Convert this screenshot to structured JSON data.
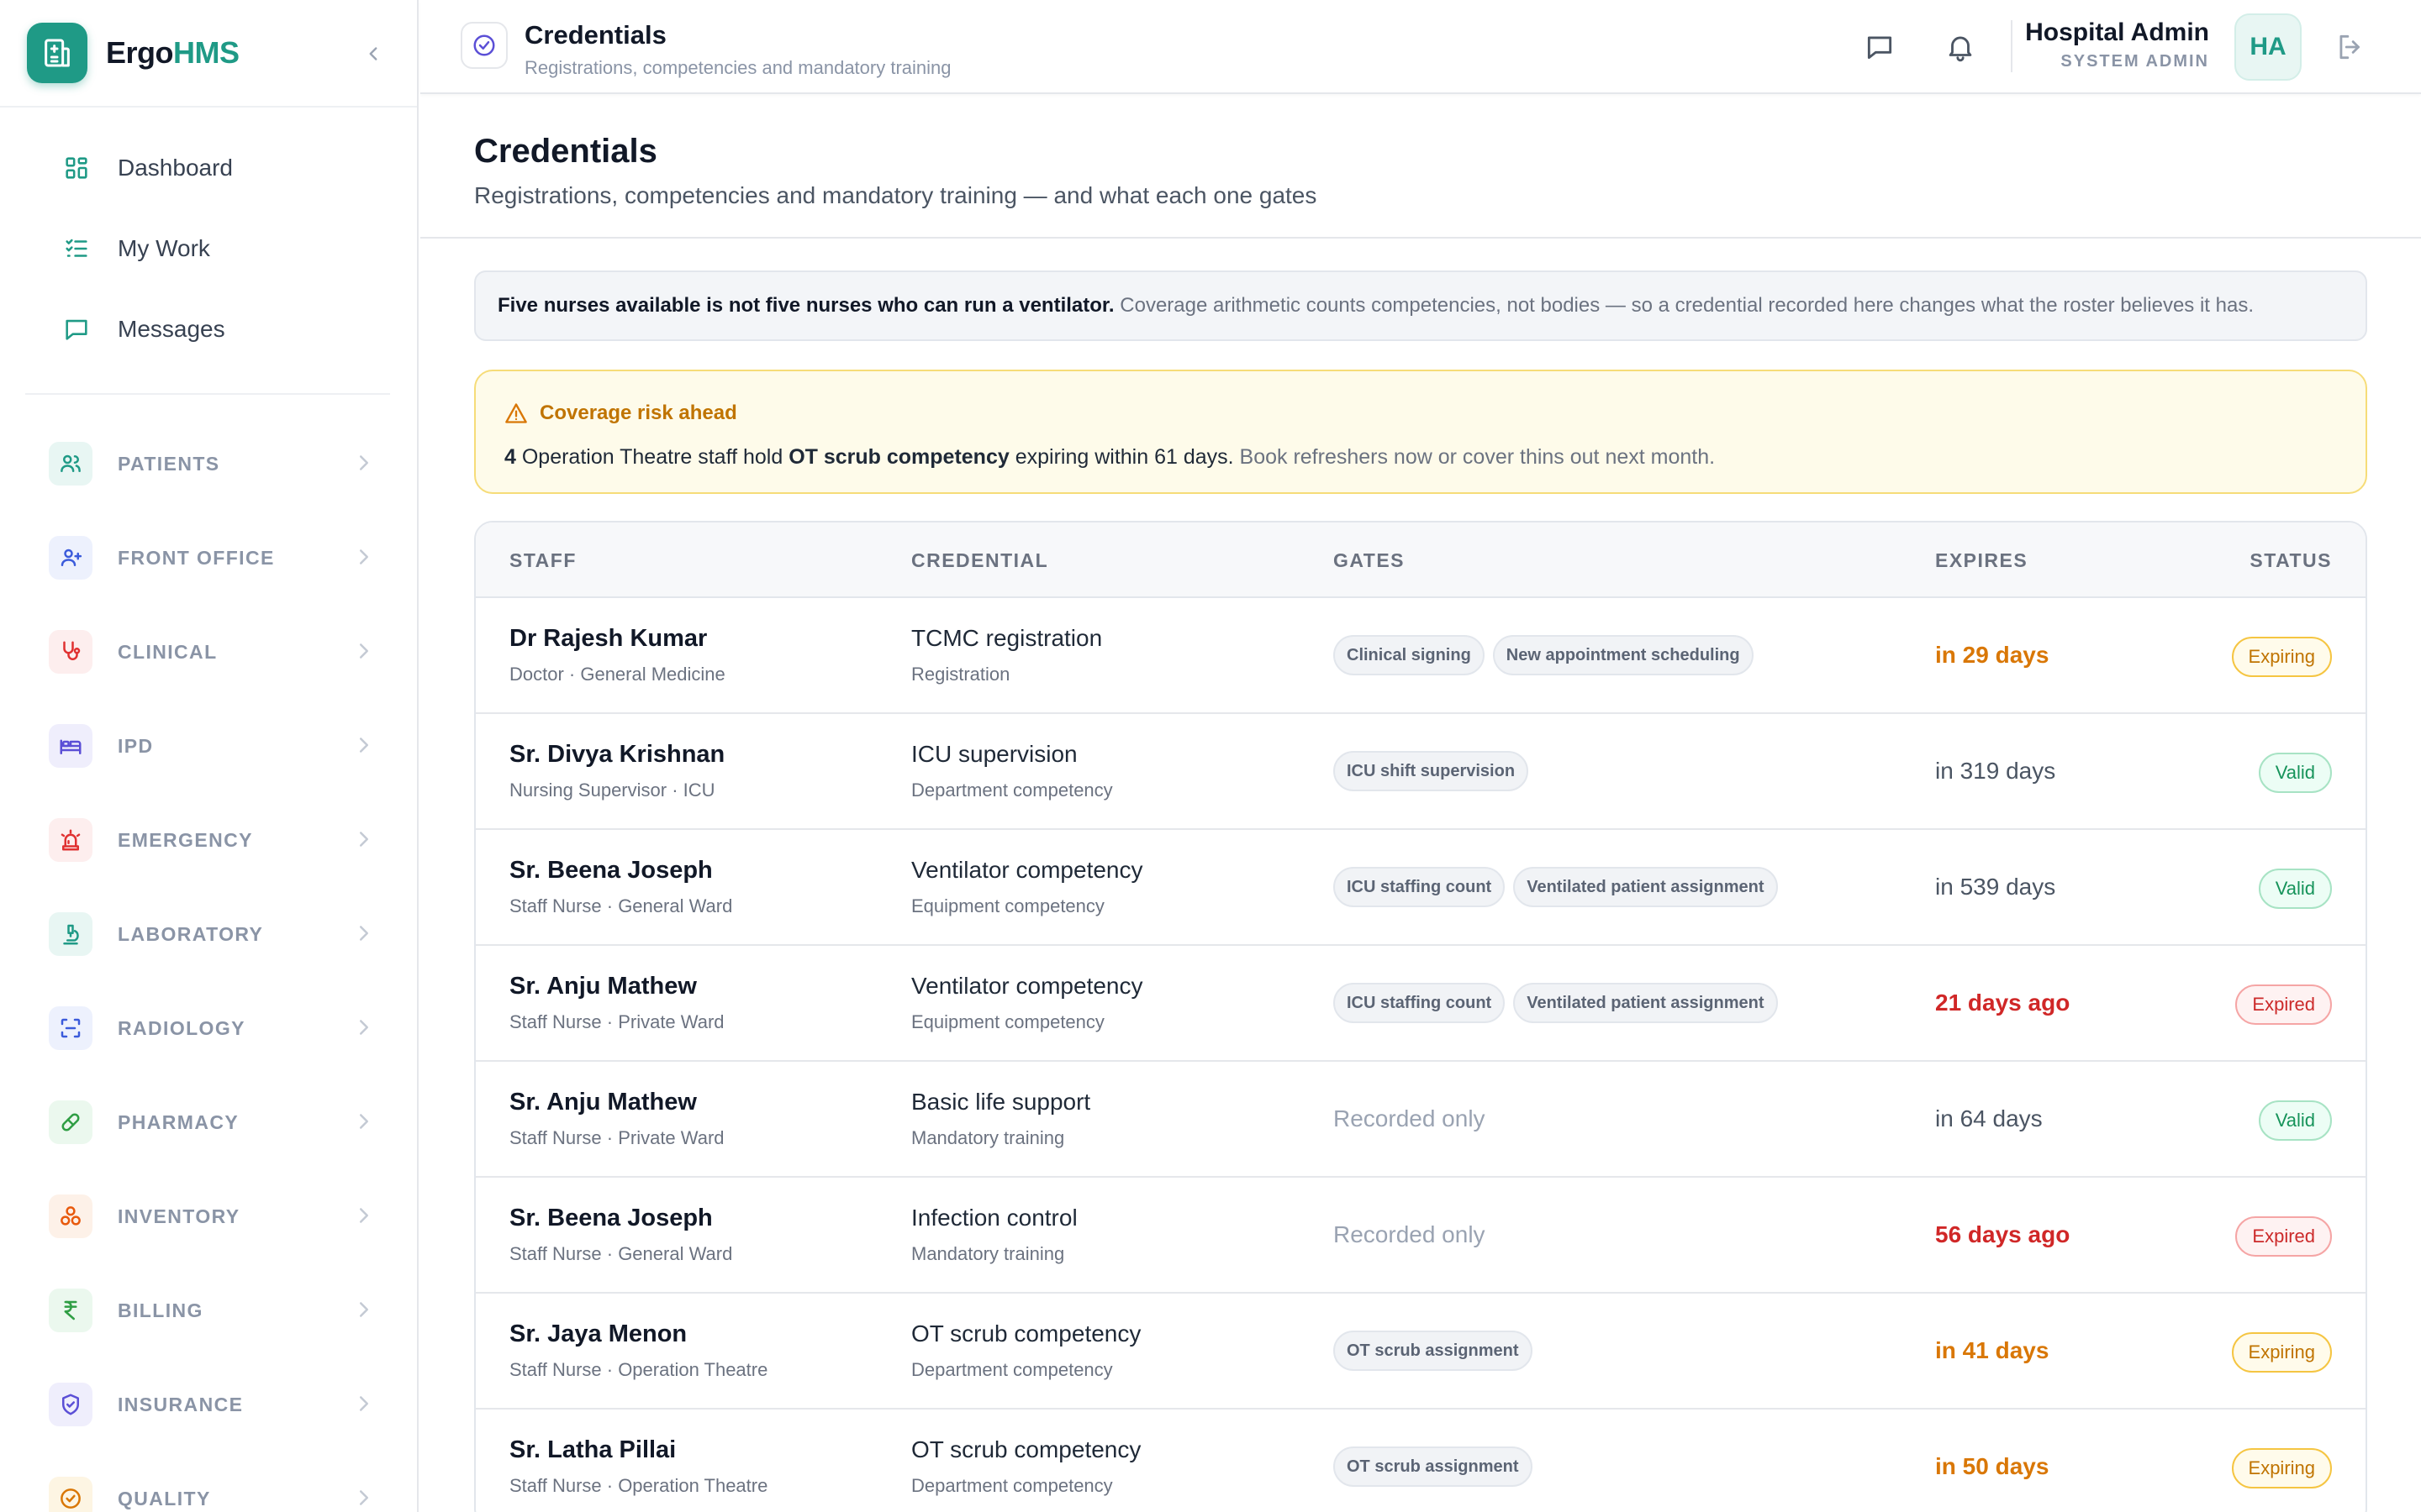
{
  "brand": {
    "name_part1": "Ergo",
    "name_part2": "HMS"
  },
  "nav_top": [
    {
      "label": "Dashboard",
      "icon": "dashboard-icon"
    },
    {
      "label": "My Work",
      "icon": "checklist-icon"
    },
    {
      "label": "Messages",
      "icon": "message-icon"
    }
  ],
  "modules": [
    {
      "label": "PATIENTS",
      "icon": "users-icon",
      "color": "#1f9a86",
      "bg": "#e8f6f3"
    },
    {
      "label": "FRONT OFFICE",
      "icon": "user-plus-icon",
      "color": "#3b5bdb",
      "bg": "#edf1fd"
    },
    {
      "label": "CLINICAL",
      "icon": "stethoscope-icon",
      "color": "#e03131",
      "bg": "#fdeeee"
    },
    {
      "label": "IPD",
      "icon": "bed-icon",
      "color": "#5b4fd6",
      "bg": "#efeefc"
    },
    {
      "label": "EMERGENCY",
      "icon": "siren-icon",
      "color": "#e03131",
      "bg": "#fdeeee"
    },
    {
      "label": "LABORATORY",
      "icon": "microscope-icon",
      "color": "#1f9a86",
      "bg": "#e8f6f3"
    },
    {
      "label": "RADIOLOGY",
      "icon": "scan-icon",
      "color": "#3b5bdb",
      "bg": "#edf1fd"
    },
    {
      "label": "PHARMACY",
      "icon": "pill-icon",
      "color": "#2f9e44",
      "bg": "#ebf8ee"
    },
    {
      "label": "INVENTORY",
      "icon": "boxes-icon",
      "color": "#e8590c",
      "bg": "#fdf1e8"
    },
    {
      "label": "BILLING",
      "icon": "rupee-icon",
      "color": "#2f9e44",
      "bg": "#ebf8ee"
    },
    {
      "label": "INSURANCE",
      "icon": "shield-icon",
      "color": "#5b4fd6",
      "bg": "#efeefc"
    },
    {
      "label": "QUALITY",
      "icon": "badge-check-icon",
      "color": "#d97706",
      "bg": "#fdf5e3"
    }
  ],
  "header": {
    "title": "Credentials",
    "subtitle": "Registrations, competencies and mandatory training",
    "user_name": "Hospital Admin",
    "user_role": "SYSTEM ADMIN",
    "avatar_initials": "HA"
  },
  "page": {
    "title": "Credentials",
    "subtitle": "Registrations, competencies and mandatory training — and what each one gates"
  },
  "note": {
    "bold": "Five nurses available is not five nurses who can run a ventilator.",
    "text": " Coverage arithmetic counts competencies, not bodies — so a credential recorded here changes what the roster believes it has."
  },
  "alert": {
    "title": "Coverage risk ahead",
    "count": "4",
    "text1": " Operation Theatre staff hold ",
    "competency": "OT scrub competency",
    "text2": " expiring within 61 days.",
    "text3": " Book refreshers now or cover thins out next month."
  },
  "table": {
    "columns": {
      "staff": "STAFF",
      "credential": "CREDENTIAL",
      "gates": "GATES",
      "expires": "EXPIRES",
      "status": "STATUS"
    },
    "rows": [
      {
        "name": "Dr Rajesh Kumar",
        "role": "Doctor · General Medicine",
        "credential": "TCMC registration",
        "type": "Registration",
        "gates": [
          "Clinical signing",
          "New appointment scheduling"
        ],
        "expires": "in 29 days",
        "exp_kind": "warn",
        "status": "Expiring",
        "status_kind": "expiring"
      },
      {
        "name": "Sr. Divya Krishnan",
        "role": "Nursing Supervisor · ICU",
        "credential": "ICU supervision",
        "type": "Department competency",
        "gates": [
          "ICU shift supervision"
        ],
        "expires": "in 319 days",
        "exp_kind": "ok",
        "status": "Valid",
        "status_kind": "valid"
      },
      {
        "name": "Sr. Beena Joseph",
        "role": "Staff Nurse · General Ward",
        "credential": "Ventilator competency",
        "type": "Equipment competency",
        "gates": [
          "ICU staffing count",
          "Ventilated patient assignment"
        ],
        "expires": "in 539 days",
        "exp_kind": "ok",
        "status": "Valid",
        "status_kind": "valid"
      },
      {
        "name": "Sr. Anju Mathew",
        "role": "Staff Nurse · Private Ward",
        "credential": "Ventilator competency",
        "type": "Equipment competency",
        "gates": [
          "ICU staffing count",
          "Ventilated patient assignment"
        ],
        "expires": "21 days ago",
        "exp_kind": "bad",
        "status": "Expired",
        "status_kind": "expired"
      },
      {
        "name": "Sr. Anju Mathew",
        "role": "Staff Nurse · Private Ward",
        "credential": "Basic life support",
        "type": "Mandatory training",
        "gates": [],
        "recorded": "Recorded only",
        "expires": "in 64 days",
        "exp_kind": "ok",
        "status": "Valid",
        "status_kind": "valid"
      },
      {
        "name": "Sr. Beena Joseph",
        "role": "Staff Nurse · General Ward",
        "credential": "Infection control",
        "type": "Mandatory training",
        "gates": [],
        "recorded": "Recorded only",
        "expires": "56 days ago",
        "exp_kind": "bad",
        "status": "Expired",
        "status_kind": "expired"
      },
      {
        "name": "Sr. Jaya Menon",
        "role": "Staff Nurse · Operation Theatre",
        "credential": "OT scrub competency",
        "type": "Department competency",
        "gates": [
          "OT scrub assignment"
        ],
        "expires": "in 41 days",
        "exp_kind": "warn",
        "status": "Expiring",
        "status_kind": "expiring"
      },
      {
        "name": "Sr. Latha Pillai",
        "role": "Staff Nurse · Operation Theatre",
        "credential": "OT scrub competency",
        "type": "Department competency",
        "gates": [
          "OT scrub assignment"
        ],
        "expires": "in 50 days",
        "exp_kind": "warn",
        "status": "Expiring",
        "status_kind": "expiring"
      }
    ]
  }
}
